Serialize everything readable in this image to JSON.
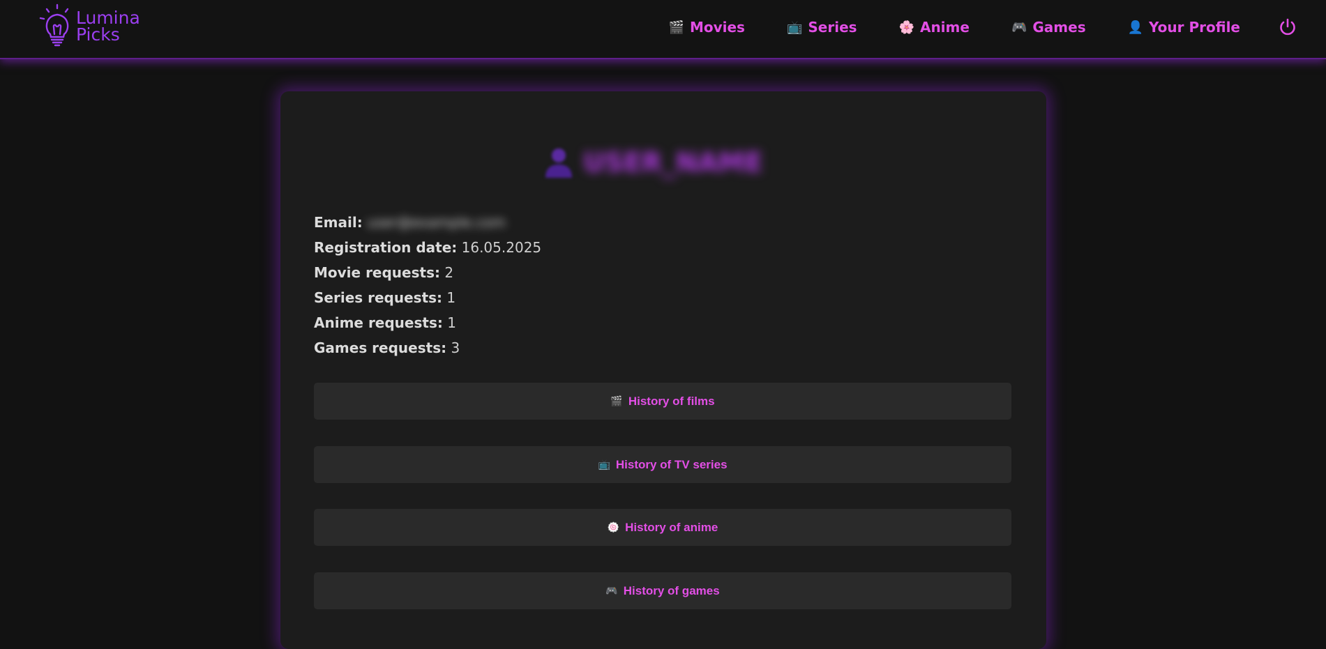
{
  "app": {
    "logo_line1": "Lumina",
    "logo_line2": "Picks",
    "accent": "#e34fe6",
    "brand": "#9b3ff0"
  },
  "nav": {
    "items": [
      {
        "icon": "🎬",
        "label": "Movies"
      },
      {
        "icon": "📺",
        "label": "Series"
      },
      {
        "icon": "🌸",
        "label": "Anime"
      },
      {
        "icon": "🎮",
        "label": "Games"
      },
      {
        "icon": "👤",
        "label": "Your Profile"
      }
    ],
    "logout_icon": "power-icon"
  },
  "profile": {
    "username": "USER_NAME",
    "email_label": "Email:",
    "email_value": "user@example.com",
    "registration_label": "Registration date:",
    "registration_value": "16.05.2025",
    "movie_label": "Movie requests:",
    "movie_value": "2",
    "series_label": "Series requests:",
    "series_value": "1",
    "anime_label": "Anime requests:",
    "anime_value": "1",
    "games_label": "Games requests:",
    "games_value": "3"
  },
  "history": [
    {
      "icon": "🎬",
      "label": "History of films"
    },
    {
      "icon": "📺",
      "label": "History of TV series"
    },
    {
      "icon": "🍥",
      "label": "History of anime"
    },
    {
      "icon": "🎮",
      "label": "History of games"
    }
  ]
}
